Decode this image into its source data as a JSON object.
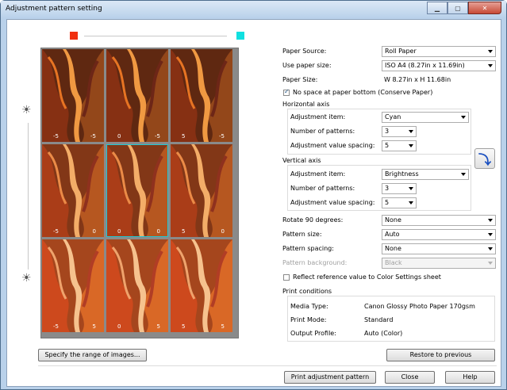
{
  "window": {
    "title": "Adjustment pattern setting"
  },
  "colors": {
    "left_square": "#f03010",
    "right_square": "#10e0e0",
    "selection": "#21c8d2"
  },
  "preview": {
    "sun_top_icon": "brightness-icon",
    "sun_bottom_icon": "brightness-icon",
    "rows": [
      [
        "-5",
        "-5",
        "0",
        "-5",
        "5",
        "-5"
      ],
      [
        "-5",
        "0",
        "0",
        "0",
        "5",
        "0"
      ],
      [
        "-5",
        "5",
        "0",
        "5",
        "5",
        "5"
      ]
    ]
  },
  "form": {
    "paper_source_label": "Paper Source:",
    "paper_source_value": "Roll Paper",
    "use_paper_size_label": "Use paper size:",
    "use_paper_size_value": "ISO A4 (8.27in x 11.69in)",
    "paper_size_label": "Paper Size:",
    "paper_size_value": "W 8.27in x H 11.68in",
    "no_space_label": "No space at paper bottom (Conserve Paper)",
    "no_space_checked": true,
    "horizontal_axis_label": "Horizontal axis",
    "h_adjustment_item_label": "Adjustment item:",
    "h_adjustment_item_value": "Cyan",
    "h_number_patterns_label": "Number of patterns:",
    "h_number_patterns_value": "3",
    "h_spacing_label": "Adjustment value spacing:",
    "h_spacing_value": "5",
    "vertical_axis_label": "Vertical axis",
    "v_adjustment_item_label": "Adjustment item:",
    "v_adjustment_item_value": "Brightness",
    "v_number_patterns_label": "Number of patterns:",
    "v_number_patterns_value": "3",
    "v_spacing_label": "Adjustment value spacing:",
    "v_spacing_value": "5",
    "rotate_label": "Rotate 90 degrees:",
    "rotate_value": "None",
    "pattern_size_label": "Pattern size:",
    "pattern_size_value": "Auto",
    "pattern_spacing_label": "Pattern spacing:",
    "pattern_spacing_value": "None",
    "pattern_background_label": "Pattern background:",
    "pattern_background_value": "Black",
    "reflect_label": "Reflect reference value to Color Settings sheet",
    "print_conditions_label": "Print conditions",
    "media_type_label": "Media Type:",
    "media_type_value": "Canon Glossy Photo Paper 170gsm",
    "print_mode_label": "Print Mode:",
    "print_mode_value": "Standard",
    "output_profile_label": "Output Profile:",
    "output_profile_value": "Auto (Color)"
  },
  "buttons": {
    "specify_range": "Specify the range of images...",
    "restore": "Restore to previous",
    "print_pattern": "Print adjustment pattern",
    "close": "Close",
    "help": "Help"
  }
}
